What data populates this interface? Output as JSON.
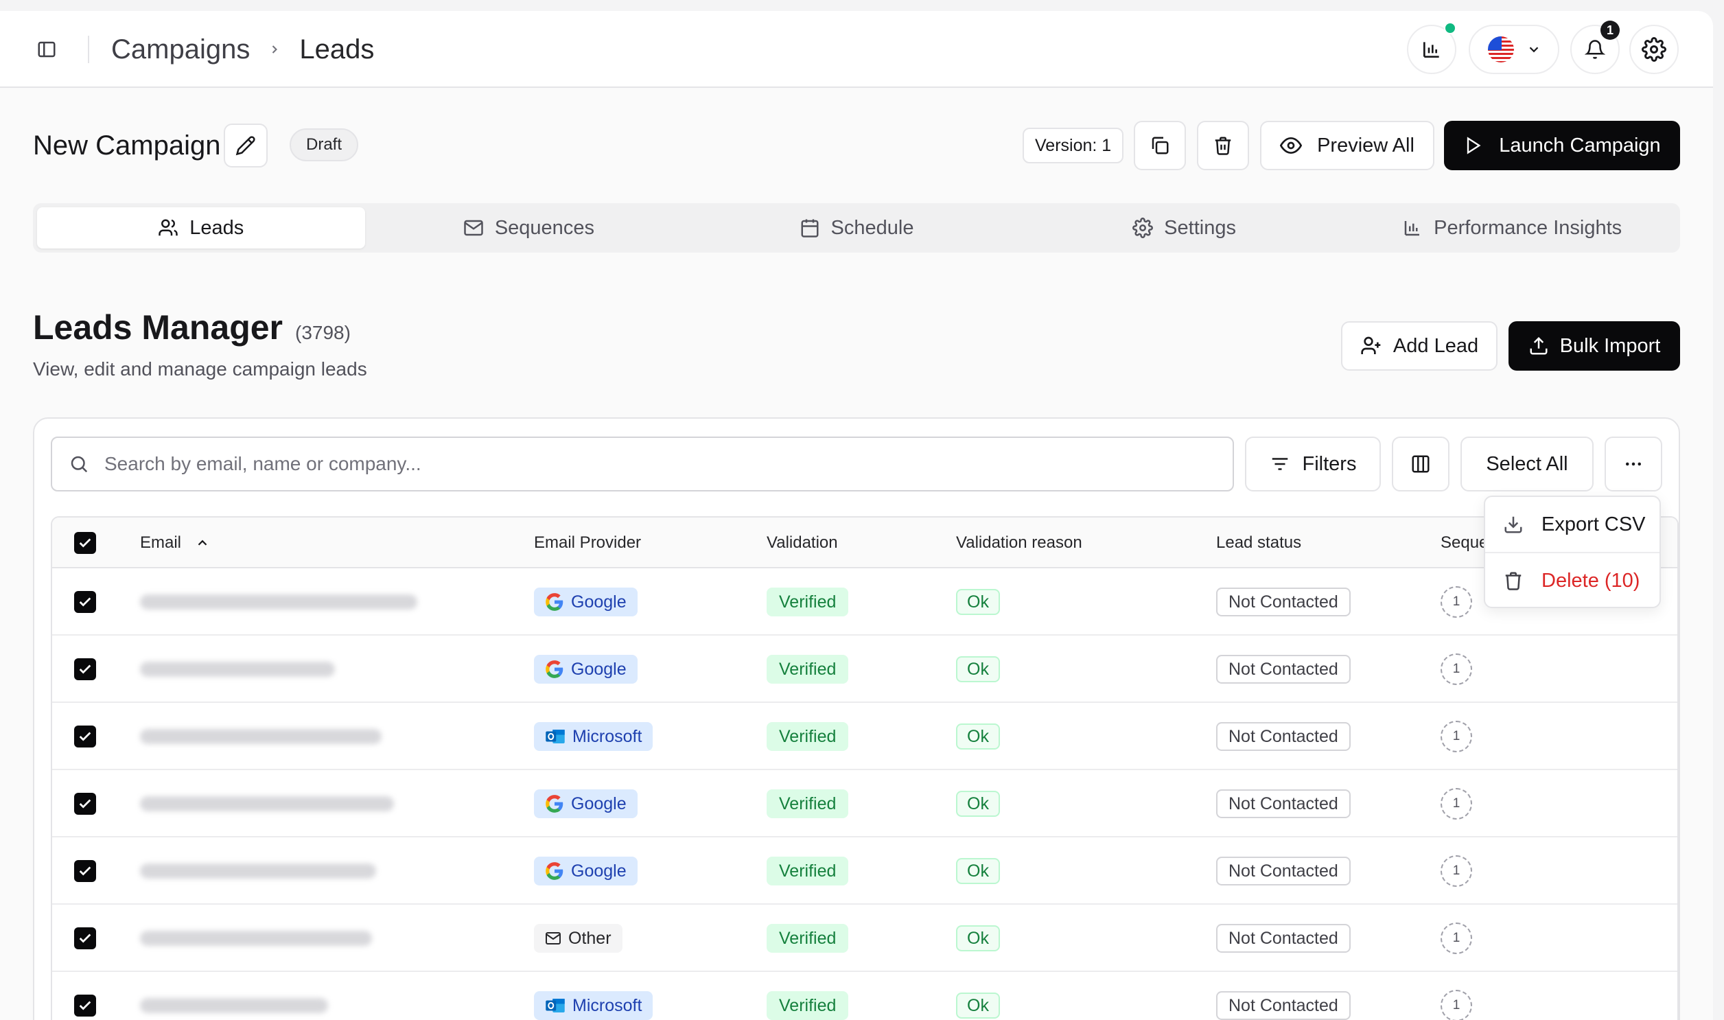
{
  "breadcrumb": {
    "root": "Campaigns",
    "current": "Leads"
  },
  "topbar": {
    "notification_count": "1",
    "status_color": "#10b981",
    "language": "us-flag"
  },
  "campaign": {
    "name": "New Campaign",
    "status": "Draft",
    "version": "Version: 1",
    "preview_label": "Preview All",
    "launch_label": "Launch Campaign"
  },
  "tabs": [
    {
      "label": "Leads",
      "icon": "users-icon",
      "active": true
    },
    {
      "label": "Sequences",
      "icon": "mail-icon",
      "active": false
    },
    {
      "label": "Schedule",
      "icon": "calendar-icon",
      "active": false
    },
    {
      "label": "Settings",
      "icon": "gear-icon",
      "active": false
    },
    {
      "label": "Performance Insights",
      "icon": "bar-chart-icon",
      "active": false
    }
  ],
  "leads_manager": {
    "title": "Leads Manager",
    "count": "(3798)",
    "subtitle": "View, edit and manage campaign leads",
    "add_lead_label": "Add Lead",
    "bulk_import_label": "Bulk Import"
  },
  "toolbar": {
    "search_placeholder": "Search by email, name or company...",
    "filters_label": "Filters",
    "select_all_label": "Select All"
  },
  "menu": {
    "export_label": "Export CSV",
    "delete_label": "Delete (10)"
  },
  "table": {
    "headers": {
      "email": "Email",
      "provider": "Email Provider",
      "validation": "Validation",
      "reason": "Validation reason",
      "status": "Lead status",
      "sequence": "Seque"
    },
    "rows": [
      {
        "provider": "Google",
        "provider_type": "google",
        "validation": "Verified",
        "reason": "Ok",
        "status": "Not Contacted",
        "seq": "1",
        "checked": true
      },
      {
        "provider": "Google",
        "provider_type": "google",
        "validation": "Verified",
        "reason": "Ok",
        "status": "Not Contacted",
        "seq": "1",
        "checked": true
      },
      {
        "provider": "Microsoft",
        "provider_type": "microsoft",
        "validation": "Verified",
        "reason": "Ok",
        "status": "Not Contacted",
        "seq": "1",
        "checked": true
      },
      {
        "provider": "Google",
        "provider_type": "google",
        "validation": "Verified",
        "reason": "Ok",
        "status": "Not Contacted",
        "seq": "1",
        "checked": true
      },
      {
        "provider": "Google",
        "provider_type": "google",
        "validation": "Verified",
        "reason": "Ok",
        "status": "Not Contacted",
        "seq": "1",
        "checked": true
      },
      {
        "provider": "Other",
        "provider_type": "other",
        "validation": "Verified",
        "reason": "Ok",
        "status": "Not Contacted",
        "seq": "1",
        "checked": true
      },
      {
        "provider": "Microsoft",
        "provider_type": "microsoft",
        "validation": "Verified",
        "reason": "Ok",
        "status": "Not Contacted",
        "seq": "1",
        "checked": true
      }
    ]
  },
  "colors": {
    "primary": "#09090b",
    "verified_bg": "#dcfce7",
    "verified_text": "#15803d",
    "delete": "#dc2626",
    "provider_bg": "#dbeafe"
  }
}
